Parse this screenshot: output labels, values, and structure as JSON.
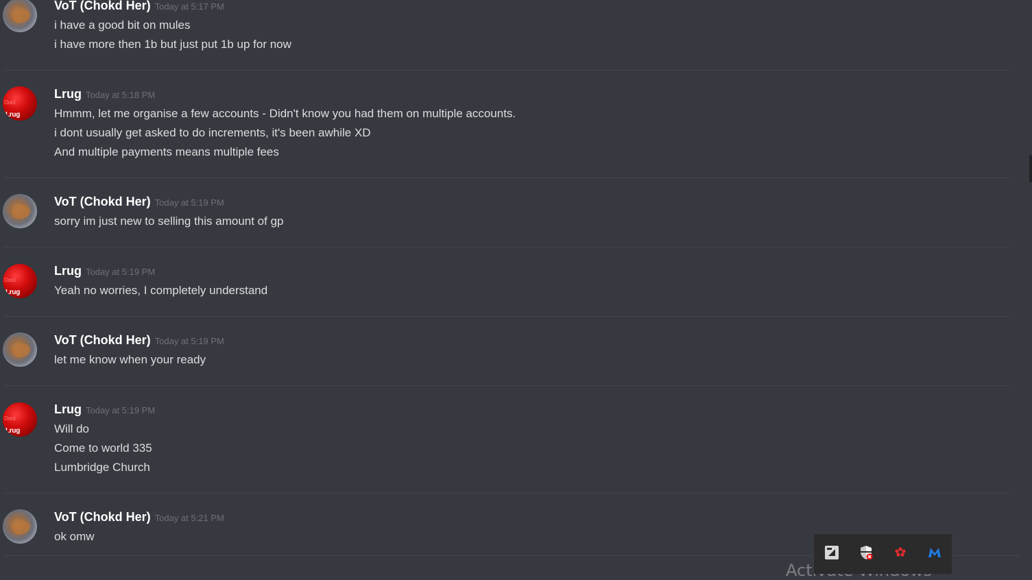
{
  "messages": [
    {
      "author": "VoT (Chokd Her)",
      "timestamp": "Today at 5:17 PM",
      "lines": [
        "i have a good bit on mules",
        "i have more then 1b but just put 1b up for now"
      ]
    },
    {
      "author": "Lrug",
      "timestamp": "Today at 5:18 PM",
      "lines": [
        "Hmmm, let me organise a few accounts - Didn't know you had them on multiple accounts.",
        "i dont usually get asked to do increments, it's been awhile XD",
        "And multiple payments means multiple fees"
      ]
    },
    {
      "author": "VoT (Chokd Her)",
      "timestamp": "Today at 5:19 PM",
      "lines": [
        "sorry im just new to selling this amount of gp"
      ]
    },
    {
      "author": "Lrug",
      "timestamp": "Today at 5:19 PM",
      "lines": [
        "Yeah no worries, I completely understand"
      ]
    },
    {
      "author": "VoT (Chokd Her)",
      "timestamp": "Today at 5:19 PM",
      "lines": [
        "let me know when your ready"
      ]
    },
    {
      "author": "Lrug",
      "timestamp": "Today at 5:19 PM",
      "lines": [
        "Will do",
        "Come to world 335",
        "Lumbridge Church"
      ]
    },
    {
      "author": "VoT (Chokd Her)",
      "timestamp": "Today at 5:21 PM",
      "lines": [
        "ok omw"
      ]
    }
  ],
  "avatars": {
    "lrug_text": "Lrug",
    "lrug_text_suffix": "Dord"
  },
  "tray": {
    "icons": [
      "tray-app-icon",
      "security-shield-icon",
      "paw-icon",
      "malwarebytes-icon"
    ]
  },
  "watermark": {
    "text": "Activate Windows"
  },
  "colors": {
    "background": "#36393f",
    "username": "#ffffff",
    "timestamp": "#6e7278",
    "text": "#dcddde",
    "divider": "#42454a"
  }
}
